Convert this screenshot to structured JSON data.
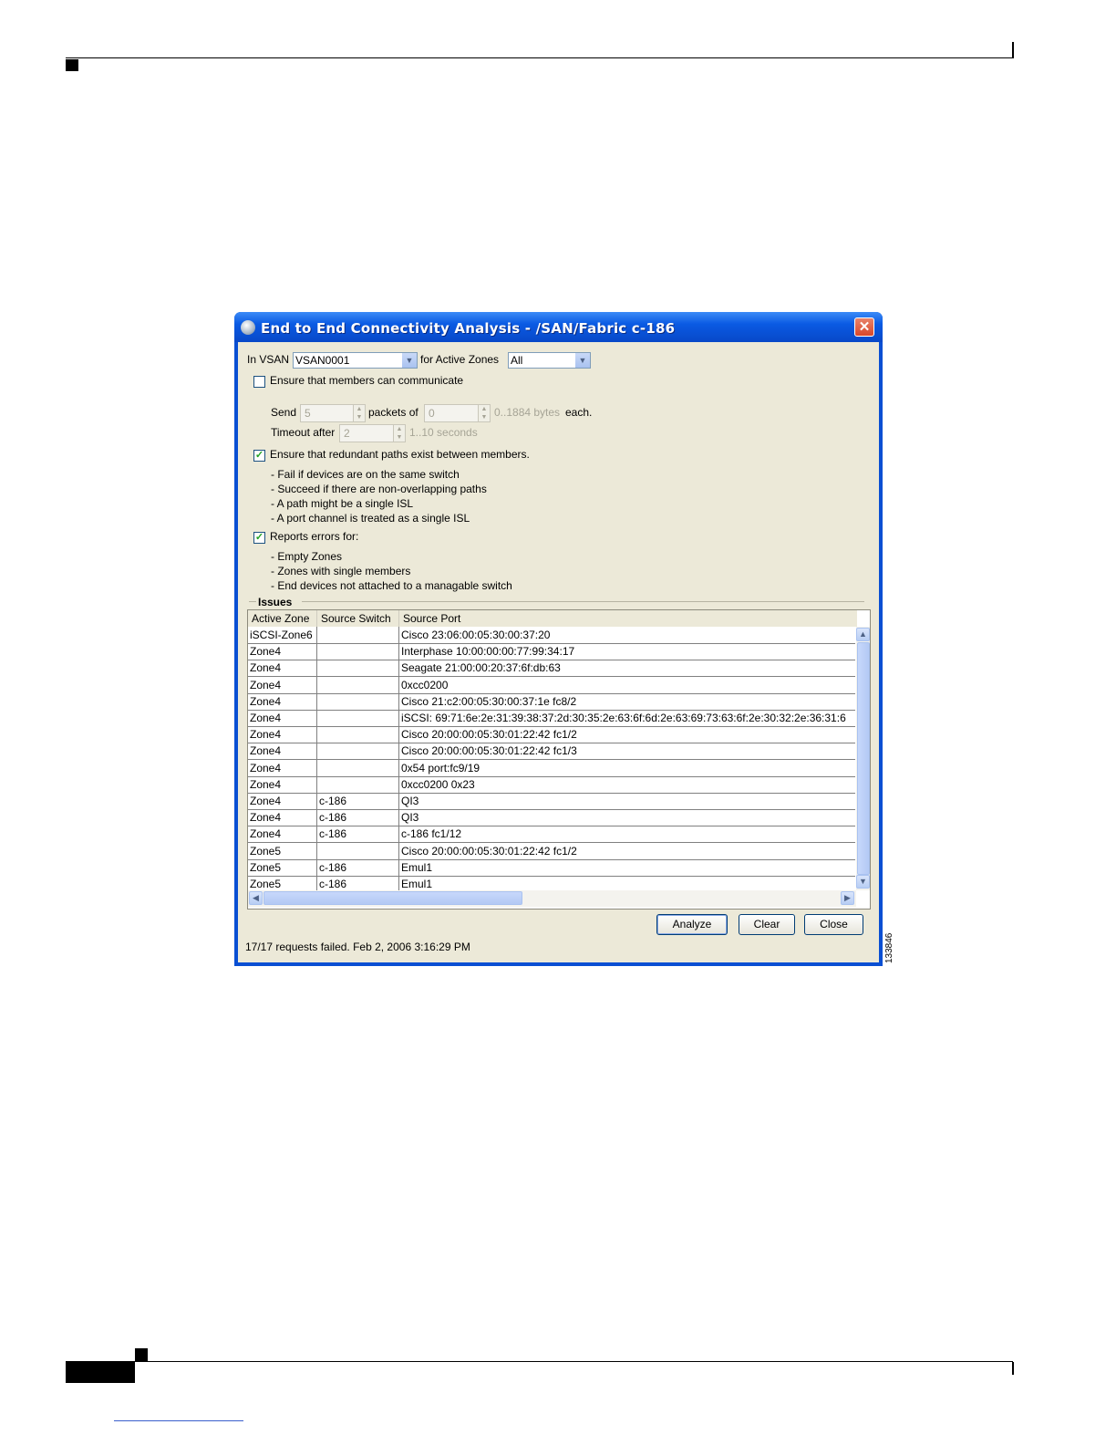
{
  "dialog": {
    "title": "End to End Connectivity Analysis - /SAN/Fabric c-186",
    "close_glyph": "✕",
    "vsan_label": "In VSAN",
    "vsan_value": "VSAN0001",
    "zones_label": "for Active Zones",
    "zones_value": "All",
    "dropdown_glyph": "▼",
    "check_glyph": "✓",
    "opt_communicate": {
      "label": "Ensure that members can communicate",
      "checked": false
    },
    "send_label": "Send",
    "send_value": "5",
    "packets_label": "packets of",
    "packets_value": "0",
    "packets_hint": "0..1884 bytes",
    "each_label": "each.",
    "timeout_label": "Timeout after",
    "timeout_value": "2",
    "timeout_hint": "1..10 seconds",
    "opt_redundant": {
      "label": "Ensure that redundant paths exist between members.",
      "checked": true
    },
    "redundant_notes": [
      "- Fail if devices are on the same switch",
      "- Succeed if there are non-overlapping paths",
      "- A path might be a single ISL",
      "- A port channel is treated as a single ISL"
    ],
    "opt_errors": {
      "label": "Reports errors for:",
      "checked": true
    },
    "error_notes": [
      "- Empty Zones",
      "- Zones with single members",
      "- End devices not attached to a managable switch"
    ],
    "issues_legend": "Issues",
    "columns": [
      "Active Zone",
      "Source Switch",
      "Source Port"
    ],
    "rows": [
      [
        "iSCSI-Zone6",
        "",
        "Cisco 23:06:00:05:30:00:37:20"
      ],
      [
        "Zone4",
        "",
        "Interphase 10:00:00:00:77:99:34:17"
      ],
      [
        "Zone4",
        "",
        "Seagate 21:00:00:20:37:6f:db:63"
      ],
      [
        "Zone4",
        "",
        "0xcc0200"
      ],
      [
        "Zone4",
        "",
        "Cisco 21:c2:00:05:30:00:37:1e fc8/2"
      ],
      [
        "Zone4",
        "",
        "iSCSI: 69:71:6e:2e:31:39:38:37:2d:30:35:2e:63:6f:6d:2e:63:69:73:63:6f:2e:30:32:2e:36:31:6"
      ],
      [
        "Zone4",
        "",
        "Cisco 20:00:00:05:30:01:22:42 fc1/2"
      ],
      [
        "Zone4",
        "",
        "Cisco 20:00:00:05:30:01:22:42 fc1/3"
      ],
      [
        "Zone4",
        "",
        "0x54 port:fc9/19"
      ],
      [
        "Zone4",
        "",
        "0xcc0200 0x23"
      ],
      [
        "Zone4",
        "c-186",
        "QI3"
      ],
      [
        "Zone4",
        "c-186",
        "QI3"
      ],
      [
        "Zone4",
        "c-186",
        "c-186 fc1/12"
      ],
      [
        "Zone5",
        "",
        "Cisco 20:00:00:05:30:01:22:42 fc1/2"
      ],
      [
        "Zone5",
        "c-186",
        "Emul1"
      ],
      [
        "Zone5",
        "c-186",
        "Emul1"
      ]
    ],
    "scroll_up": "▲",
    "scroll_down": "▼",
    "scroll_left": "◀",
    "scroll_right": "▶",
    "btn_analyze": "Analyze",
    "btn_clear": "Clear",
    "btn_close": "Close",
    "status": "17/17 requests failed.  Feb 2, 2006 3:16:29 PM"
  },
  "figure_id": "133846"
}
